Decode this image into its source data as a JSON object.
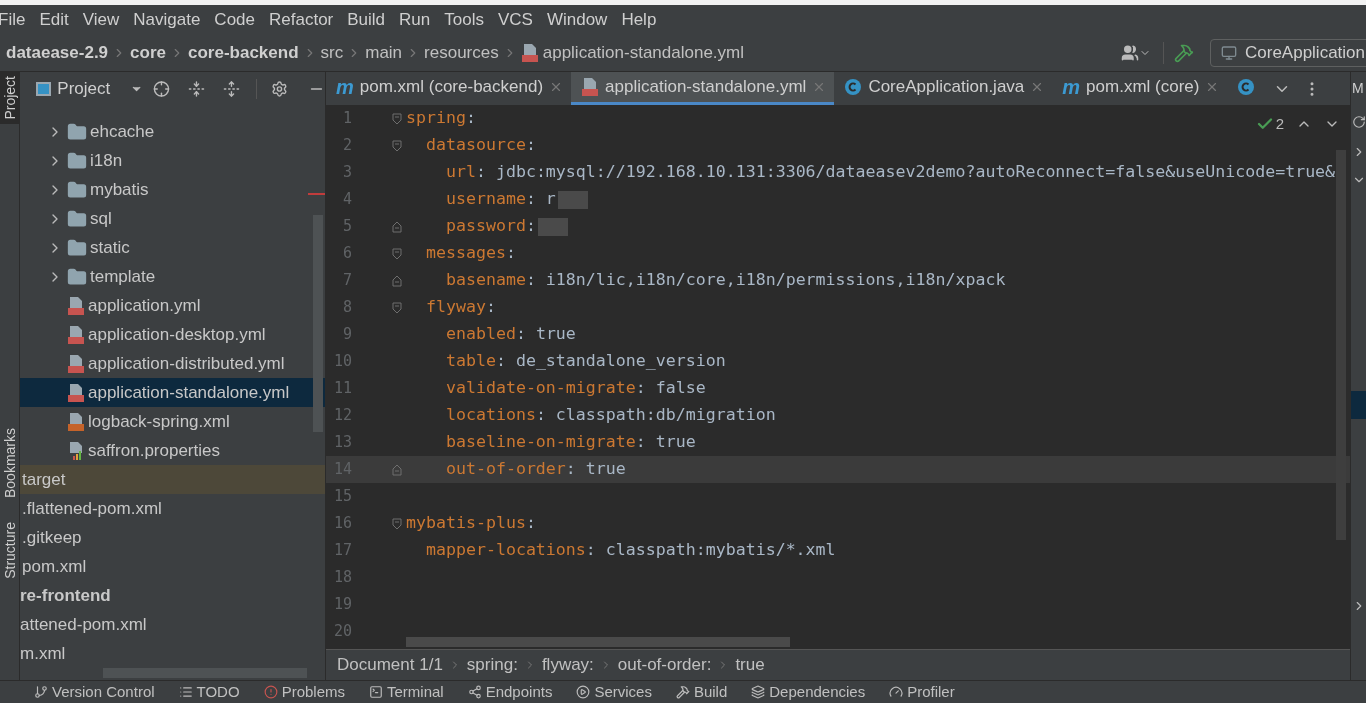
{
  "menu": [
    "File",
    "Edit",
    "View",
    "Navigate",
    "Code",
    "Refactor",
    "Build",
    "Run",
    "Tools",
    "VCS",
    "Window",
    "Help"
  ],
  "breadcrumb": [
    {
      "label": "dataease-2.9",
      "bold": true,
      "kind": "plain"
    },
    {
      "label": "core",
      "bold": true,
      "kind": "plain"
    },
    {
      "label": "core-backend",
      "bold": true,
      "kind": "plain"
    },
    {
      "label": "src",
      "bold": false,
      "kind": "plain"
    },
    {
      "label": "main",
      "bold": false,
      "kind": "plain"
    },
    {
      "label": "resources",
      "bold": false,
      "kind": "plain"
    },
    {
      "label": "application-standalone.yml",
      "bold": false,
      "kind": "yaml"
    }
  ],
  "run_config": {
    "label": "CoreApplication"
  },
  "left_stripe": [
    {
      "label": "Project",
      "selected": true
    },
    {
      "label": "Bookmarks",
      "selected": false
    },
    {
      "label": "Structure",
      "selected": false
    }
  ],
  "project_panel": {
    "title": "Project",
    "items": [
      {
        "label": "ehcache",
        "kind": "folder",
        "selected": false,
        "bold": false
      },
      {
        "label": "i18n",
        "kind": "folder",
        "selected": false,
        "bold": false
      },
      {
        "label": "mybatis",
        "kind": "folder",
        "selected": false,
        "bold": false
      },
      {
        "label": "sql",
        "kind": "folder",
        "selected": false,
        "bold": false
      },
      {
        "label": "static",
        "kind": "folder",
        "selected": false,
        "bold": false
      },
      {
        "label": "template",
        "kind": "folder",
        "selected": false,
        "bold": false
      },
      {
        "label": "application.yml",
        "kind": "yaml",
        "selected": false,
        "bold": false
      },
      {
        "label": "application-desktop.yml",
        "kind": "yaml",
        "selected": false,
        "bold": false
      },
      {
        "label": "application-distributed.yml",
        "kind": "yaml",
        "selected": false,
        "bold": false
      },
      {
        "label": "application-standalone.yml",
        "kind": "yaml",
        "selected": true,
        "bold": false
      },
      {
        "label": "logback-spring.xml",
        "kind": "xml",
        "selected": false,
        "bold": false
      },
      {
        "label": "saffron.properties",
        "kind": "properties",
        "selected": false,
        "bold": false
      },
      {
        "label": "target",
        "kind": "excluded",
        "selected": false,
        "bold": false
      },
      {
        "label": ".flattened-pom.xml",
        "kind": "outer",
        "selected": false,
        "bold": false
      },
      {
        "label": ".gitkeep",
        "kind": "outer",
        "selected": false,
        "bold": false
      },
      {
        "label": "pom.xml",
        "kind": "outer",
        "selected": false,
        "bold": false
      },
      {
        "label": "re-frontend",
        "kind": "cut",
        "selected": false,
        "bold": true
      },
      {
        "label": "attened-pom.xml",
        "kind": "cut",
        "selected": false,
        "bold": false
      },
      {
        "label": "m.xml",
        "kind": "cut",
        "selected": false,
        "bold": false
      }
    ]
  },
  "tabs": [
    {
      "label": "pom.xml (core-backend)",
      "kind": "maven",
      "badge": "m",
      "selected": false
    },
    {
      "label": "application-standalone.yml",
      "kind": "yaml",
      "selected": true
    },
    {
      "label": "CoreApplication.java",
      "kind": "java",
      "selected": false
    },
    {
      "label": "pom.xml (core)",
      "kind": "maven",
      "badge": "m",
      "selected": false
    },
    {
      "kind": "java",
      "selected": false
    }
  ],
  "right_stripe": {
    "label": "M"
  },
  "inspections": {
    "count": "2"
  },
  "lines": [
    {
      "number": "1",
      "key": "spring",
      "value": ":",
      "fold_open": true
    },
    {
      "number": "2",
      "key": "  datasource",
      "value": ":",
      "fold_open": true
    },
    {
      "number": "3",
      "key": "    url",
      "value": ": jdbc:mysql://192.168.10.131:3306/dataeasev2demo?autoReconnect=false&useUnicode=true&"
    },
    {
      "number": "4",
      "key": "    username",
      "value": ": r",
      "redacted": true
    },
    {
      "number": "5",
      "key": "    password",
      "value": ":",
      "redacted": true,
      "fold_close": true
    },
    {
      "number": "6",
      "key": "  messages",
      "value": ":",
      "fold_open": true
    },
    {
      "number": "7",
      "key": "    basename",
      "value": ": i18n/lic,i18n/core,i18n/permissions,i18n/xpack",
      "fold_close": true
    },
    {
      "number": "8",
      "key": "  flyway",
      "value": ":",
      "fold_open": true
    },
    {
      "number": "9",
      "key": "    enabled",
      "value": ": true"
    },
    {
      "number": "10",
      "key": "    table",
      "value": ": de_standalone_version"
    },
    {
      "number": "11",
      "key": "    validate-on-migrate",
      "value": ": false"
    },
    {
      "number": "12",
      "key": "    locations",
      "value": ": classpath:db/migration"
    },
    {
      "number": "13",
      "key": "    baseline-on-migrate",
      "value": ": true"
    },
    {
      "number": "14",
      "key": "    out-of-order",
      "value": ": true",
      "fold_close": true,
      "current": true
    },
    {
      "number": "15"
    },
    {
      "number": "16",
      "key": "mybatis-plus",
      "value": ":",
      "fold_open": true
    },
    {
      "number": "17",
      "key": "  mapper-locations",
      "value": ": classpath:mybatis/*.xml"
    },
    {
      "number": "18"
    },
    {
      "number": "19"
    },
    {
      "number": "20"
    }
  ],
  "editor_breadcrumb": [
    "Document 1/1",
    "spring:",
    "flyway:",
    "out-of-order:",
    "true"
  ],
  "tool_windows": [
    {
      "label": "Version Control",
      "kind": "vcs"
    },
    {
      "label": "TODO",
      "kind": "todo"
    },
    {
      "label": "Problems",
      "kind": "problems"
    },
    {
      "label": "Terminal",
      "kind": "terminal"
    },
    {
      "label": "Endpoints",
      "kind": "endpoints"
    },
    {
      "label": "Services",
      "kind": "services"
    },
    {
      "label": "Build",
      "kind": "build"
    },
    {
      "label": "Dependencies",
      "kind": "dependencies"
    },
    {
      "label": "Profiler",
      "kind": "profiler"
    }
  ]
}
